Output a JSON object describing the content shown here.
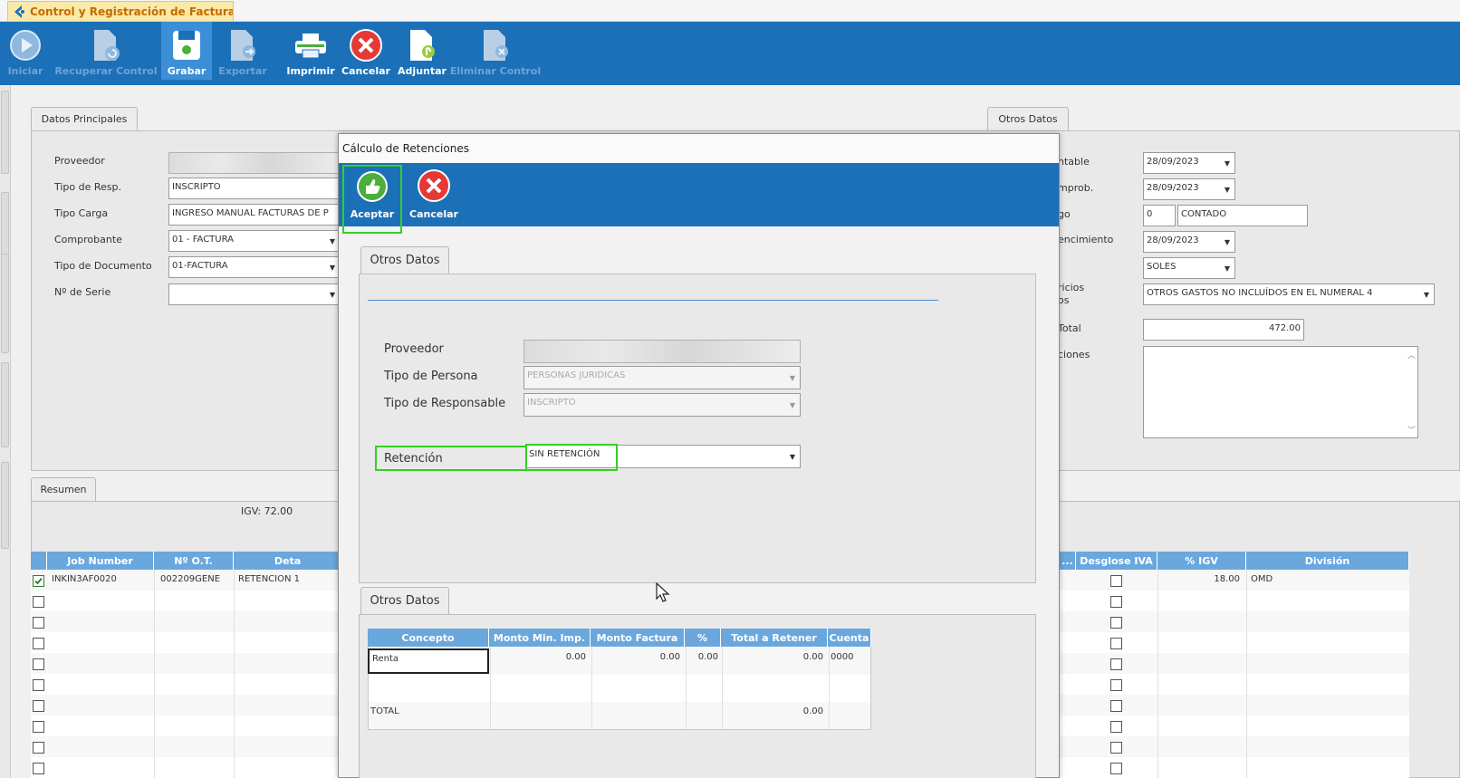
{
  "app": {
    "tab_title": "Control y Registración de Factura..."
  },
  "toolbar": {
    "iniciar": "Iniciar",
    "recuperar": "Recuperar Control",
    "grabar": "Grabar",
    "exportar": "Exportar",
    "imprimir": "Imprimir",
    "cancelar": "Cancelar",
    "adjuntar": "Adjuntar",
    "eliminar": "Eliminar Control"
  },
  "datos_principales": {
    "tab": "Datos Principales",
    "proveedor_label": "Proveedor",
    "tipo_resp_label": "Tipo de Resp.",
    "tipo_resp_value": "INSCRIPTO",
    "tipo_carga_label": "Tipo Carga",
    "tipo_carga_value": "INGRESO MANUAL FACTURAS DE P",
    "comprobante_label": "Comprobante",
    "comprobante_value": "01 - FACTURA",
    "tipo_doc_label": "Tipo de Documento",
    "tipo_doc_value": "01-FACTURA",
    "serie_label": "Nº de Serie",
    "serie_value": ""
  },
  "otros_datos_bg": {
    "tab": "Otros Datos",
    "contable_label": "ntable",
    "contable_value": "28/09/2023",
    "comprob_label": "mprob.",
    "comprob_value": "28/09/2023",
    "pago_label": "go",
    "pago_code": "0",
    "pago_value": "CONTADO",
    "vencimiento_label": "encimiento",
    "vencimiento_value": "28/09/2023",
    "moneda_value": "SOLES",
    "servicios_label1": "ricios",
    "servicios_label2": "os",
    "servicios_value": "OTROS GASTOS NO INCLUÍDOS EN EL NUMERAL 4",
    "total_label": "Total",
    "total_value": "472.00",
    "observ_label": "ciones"
  },
  "resumen": {
    "tab": "Resumen",
    "igv": "IGV: 72.00",
    "headers": {
      "job": "Job Number",
      "ot": "Nº O.T.",
      "det": "Deta",
      "dots": "...",
      "desglose": "Desglose IVA",
      "igv": "% IGV",
      "division": "División"
    },
    "row1": {
      "job": "INKIN3AF0020",
      "ot": "002209GENE",
      "det": "RETENCION 1",
      "igv": "18.00",
      "division": "OMD"
    }
  },
  "dialog": {
    "title": "Cálculo de Retenciones",
    "aceptar": "Aceptar",
    "cancelar": "Cancelar",
    "tab1": "Otros Datos",
    "proveedor_label": "Proveedor",
    "tipo_persona_label": "Tipo de Persona",
    "tipo_persona_value": "PERSONAS JURIDICAS",
    "tipo_resp_label": "Tipo de Responsable",
    "tipo_resp_value": "INSCRIPTO",
    "retencion_label": "Retención",
    "retencion_value": "SIN RETENCIÓN",
    "tab2": "Otros Datos",
    "table": {
      "headers": {
        "concepto": "Concepto",
        "monto_min": "Monto Min. Imp.",
        "monto_factura": "Monto Factura",
        "pct": "%",
        "total_retener": "Total a Retener",
        "cuenta": "Cuenta"
      },
      "row1": {
        "concepto": "Renta",
        "monto_min": "0.00",
        "monto_factura": "0.00",
        "pct": "0.00",
        "total_retener": "0.00",
        "cuenta": "0000"
      },
      "total_label": "TOTAL",
      "total_value": "0.00"
    }
  },
  "colors": {
    "ribbon": "#1b70b8",
    "grid_header": "#6aa7dd",
    "highlight": "#34d023"
  }
}
